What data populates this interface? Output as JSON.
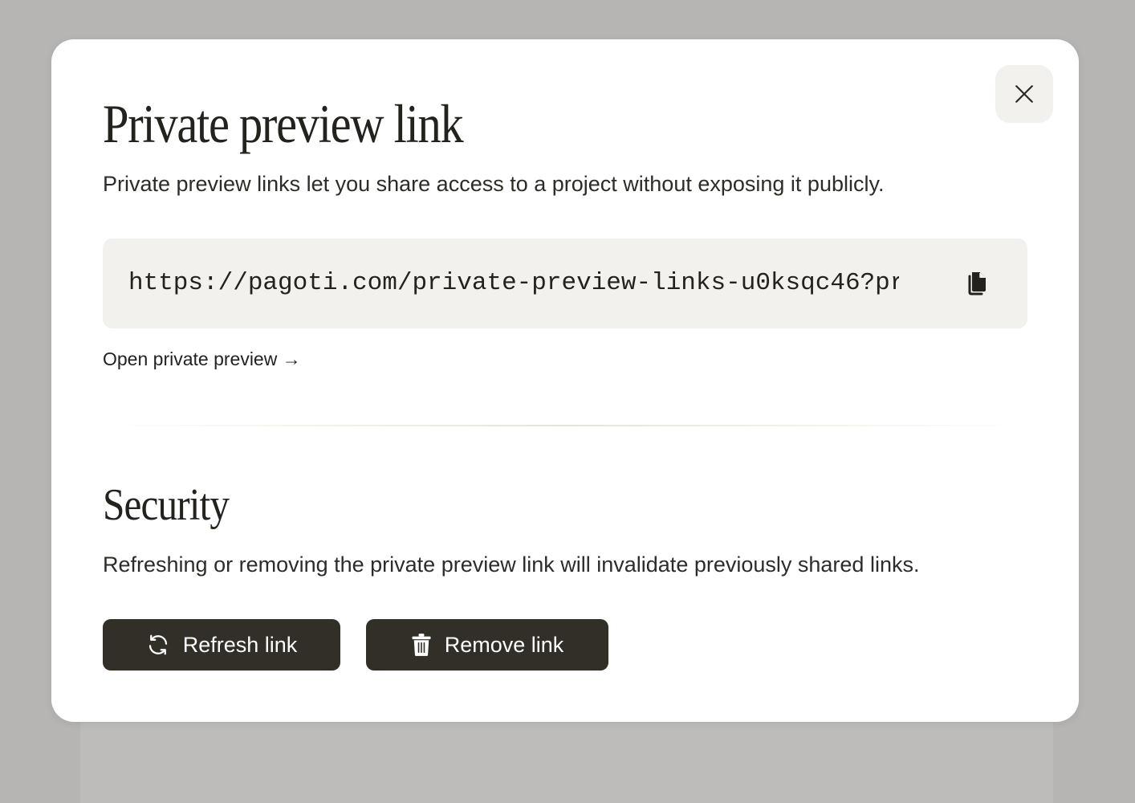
{
  "modal": {
    "title": "Private preview link",
    "description": "Private preview links let you share access to a project without exposing it publicly.",
    "link_url": "https://pagoti.com/private-preview-links-u0ksqc46?pr",
    "open_link_label": "Open private preview →",
    "close_icon": "close-icon",
    "copy_icon": "copy-icon"
  },
  "security": {
    "title": "Security",
    "description": "Refreshing or removing the private preview link will invalidate previously shared links.",
    "refresh_label": "Refresh link",
    "refresh_icon": "refresh-icon",
    "remove_label": "Remove link",
    "remove_icon": "trash-icon"
  },
  "colors": {
    "overlay": "#b6b5b4",
    "button_bg": "#322f29",
    "field_bg": "#f2f1ed",
    "text": "#24221d"
  }
}
